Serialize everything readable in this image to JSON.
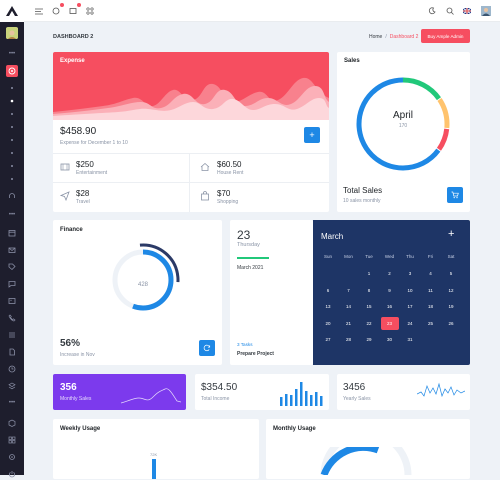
{
  "header": {
    "breadcrumb_home": "Home",
    "breadcrumb_sep": "/",
    "breadcrumb_current": "Dashboard 2",
    "page_title": "DASHBOARD 2",
    "buy_button": "Buy Ample Admin"
  },
  "sidebar": {
    "dots": [
      "•••",
      "•••"
    ]
  },
  "expense": {
    "title": "Expense",
    "amount": "$458.90",
    "subtitle": "Expense for December 1 to 10",
    "add_label": "+",
    "items": [
      {
        "amount": "$250",
        "label": "Entertainment",
        "icon": "film-icon"
      },
      {
        "amount": "$60.50",
        "label": "House Rent",
        "icon": "home-icon"
      },
      {
        "amount": "$28",
        "label": "Travel",
        "icon": "send-icon"
      },
      {
        "amount": "$70",
        "label": "Shopping",
        "icon": "bag-icon"
      }
    ]
  },
  "sales": {
    "title": "Sales",
    "center_month": "April",
    "center_value": "170",
    "total_label": "Total Sales",
    "total_sub": "10 sales monthly",
    "cart_icon": "cart-icon",
    "colors": {
      "blue": "#1e88e5",
      "green": "#21c87a",
      "orange": "#ffc36d",
      "red": "#f64e60"
    }
  },
  "finance": {
    "title": "Finance",
    "center_value": "428",
    "percent": "56%",
    "percent_label": "Increase in Nov"
  },
  "date_card": {
    "day": "23",
    "weekday": "Thursday",
    "month_year": "March 2021",
    "tasks": "3 Tasks",
    "task_name": "Prepare Project"
  },
  "calendar": {
    "month": "March",
    "add_label": "+",
    "weekdays": [
      "Sun",
      "Mon",
      "Tue",
      "Wed",
      "Thu",
      "Fri",
      "Sat"
    ],
    "weeks": [
      [
        "",
        "",
        "1",
        "2",
        "3",
        "4",
        "5"
      ],
      [
        "6",
        "7",
        "8",
        "9",
        "10",
        "11",
        "12"
      ],
      [
        "13",
        "14",
        "15",
        "16",
        "17",
        "18",
        "19"
      ],
      [
        "20",
        "21",
        "22",
        "23",
        "24",
        "25",
        "26"
      ],
      [
        "27",
        "28",
        "29",
        "30",
        "31",
        "",
        ""
      ]
    ],
    "selected": "23"
  },
  "stats": [
    {
      "value": "356",
      "label": "Monthly Sales"
    },
    {
      "value": "$354.50",
      "label": "Total Income"
    },
    {
      "value": "3456",
      "label": "Yearly Sales"
    }
  ],
  "weekly": {
    "title": "Weekly Usage",
    "bar_label": "72K"
  },
  "monthly": {
    "title": "Monthly Usage"
  }
}
